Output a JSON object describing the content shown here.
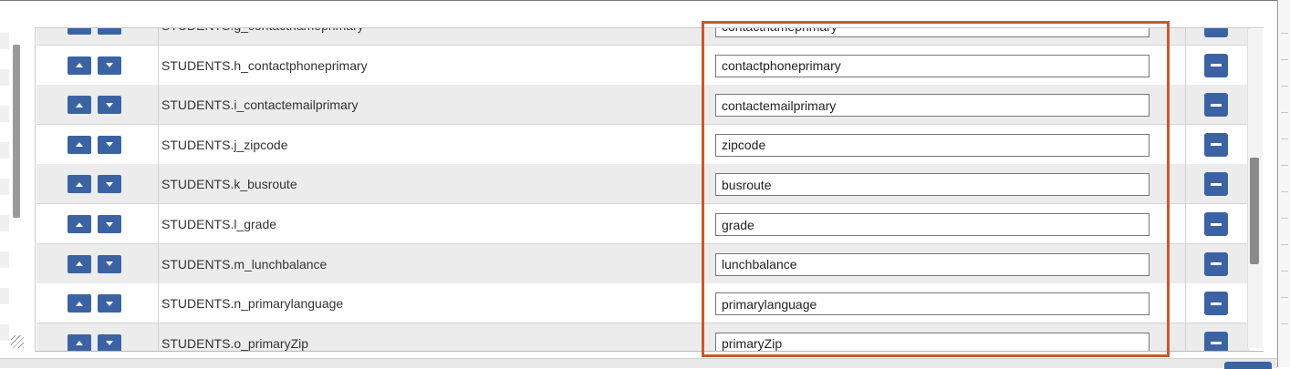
{
  "rows": [
    {
      "field": "STUDENTS.g_contactnameprimary",
      "value": "contactnameprimary"
    },
    {
      "field": "STUDENTS.h_contactphoneprimary",
      "value": "contactphoneprimary"
    },
    {
      "field": "STUDENTS.i_contactemailprimary",
      "value": "contactemailprimary"
    },
    {
      "field": "STUDENTS.j_zipcode",
      "value": "zipcode"
    },
    {
      "field": "STUDENTS.k_busroute",
      "value": "busroute"
    },
    {
      "field": "STUDENTS.l_grade",
      "value": "grade"
    },
    {
      "field": "STUDENTS.m_lunchbalance",
      "value": "lunchbalance"
    },
    {
      "field": "STUDENTS.n_primarylanguage",
      "value": "primarylanguage"
    },
    {
      "field": "STUDENTS.o_primaryZip",
      "value": "primaryZip"
    }
  ],
  "icons": {
    "move_up": "chevron-up-icon",
    "move_down": "chevron-down-icon",
    "remove": "minus-icon"
  },
  "colors": {
    "button": "#3b63a4",
    "highlight_border": "#c45a30",
    "row_alt": "#ececec"
  }
}
